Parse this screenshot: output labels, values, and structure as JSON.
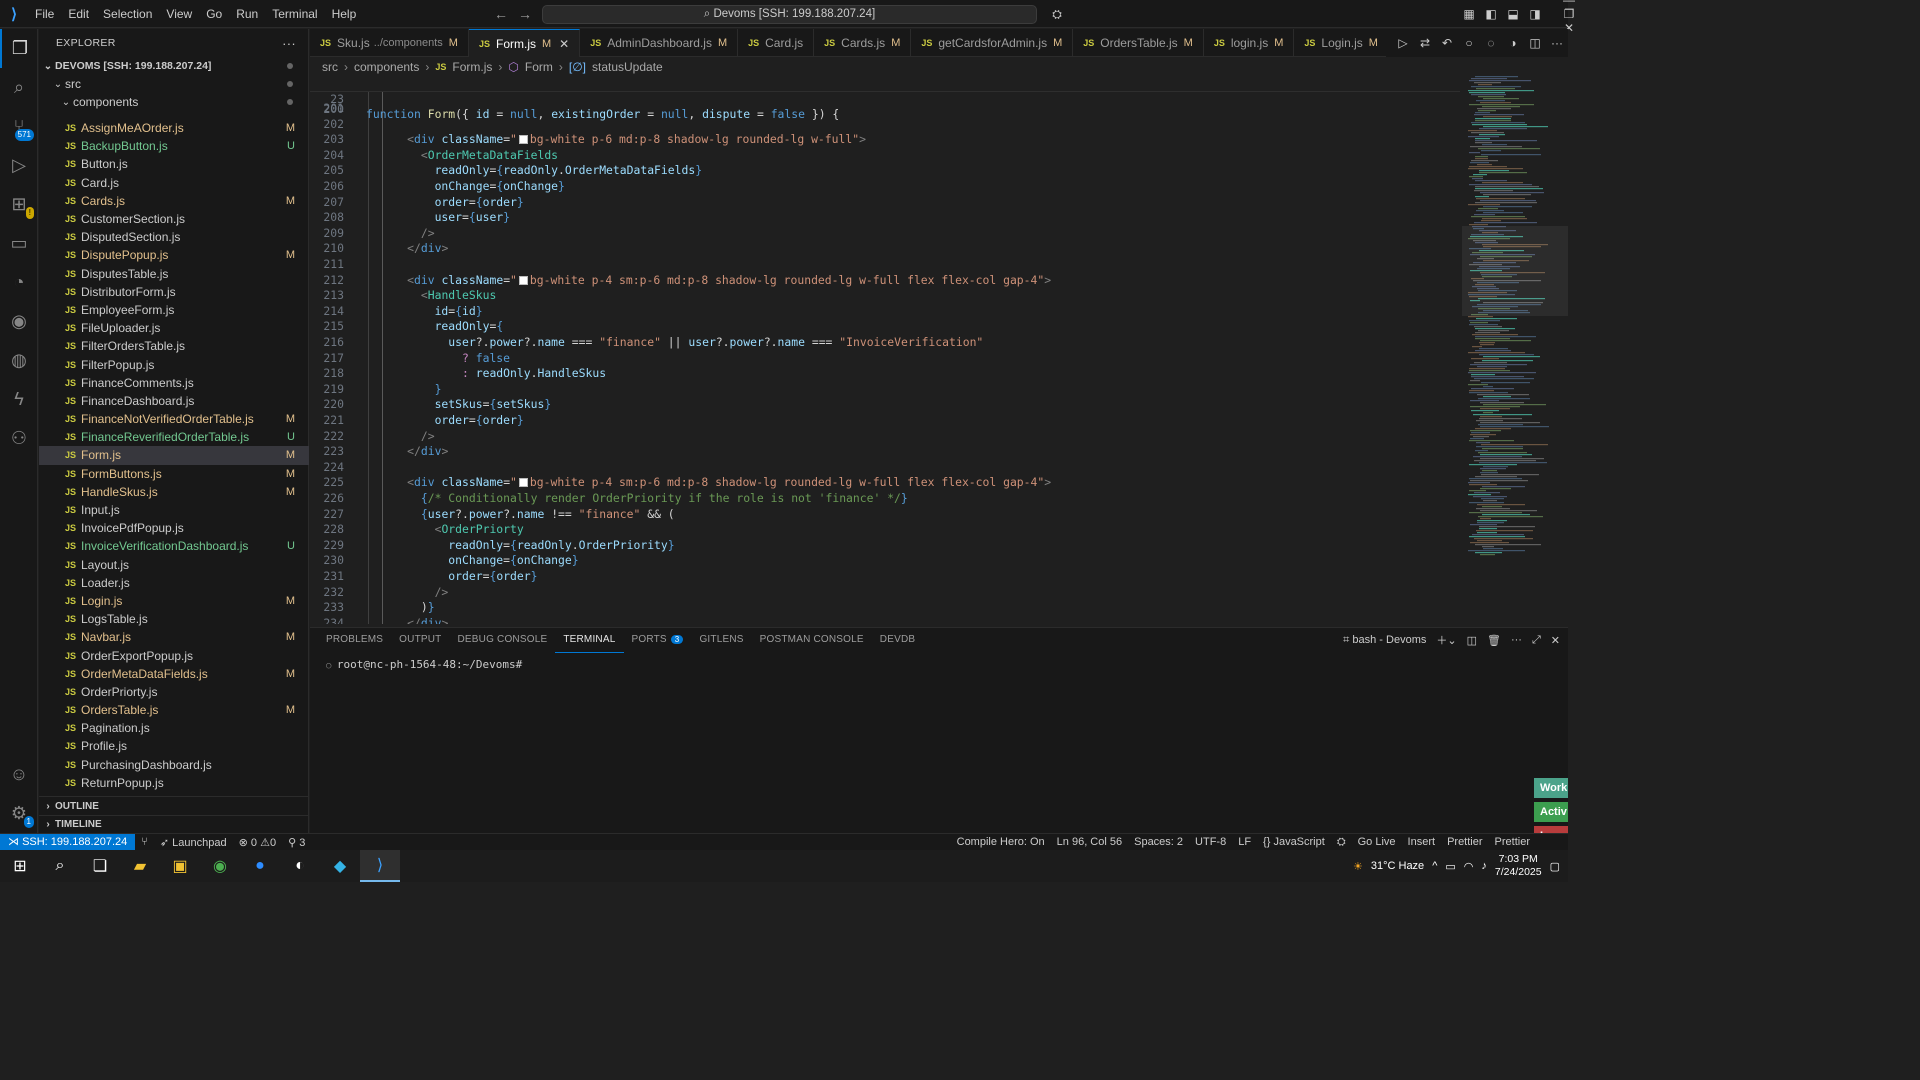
{
  "titlebar": {
    "menu": [
      "File",
      "Edit",
      "Selection",
      "View",
      "Go",
      "Run",
      "Terminal",
      "Help"
    ],
    "command_center": "Devoms [SSH: 199.188.207.24]"
  },
  "activity": {
    "scm_badge": "571",
    "settings_badge": "1"
  },
  "sidebar": {
    "title": "EXPLORER",
    "root": "DEVOMS [SSH: 199.188.207.24]",
    "src": "src",
    "components": "components",
    "files": [
      {
        "name": "AssignMeAOrder.js",
        "status": "M"
      },
      {
        "name": "BackupButton.js",
        "status": "U"
      },
      {
        "name": "Button.js",
        "status": ""
      },
      {
        "name": "Card.js",
        "status": ""
      },
      {
        "name": "Cards.js",
        "status": "M"
      },
      {
        "name": "CustomerSection.js",
        "status": ""
      },
      {
        "name": "DisputedSection.js",
        "status": ""
      },
      {
        "name": "DisputePopup.js",
        "status": "M"
      },
      {
        "name": "DisputesTable.js",
        "status": ""
      },
      {
        "name": "DistributorForm.js",
        "status": ""
      },
      {
        "name": "EmployeeForm.js",
        "status": ""
      },
      {
        "name": "FileUploader.js",
        "status": ""
      },
      {
        "name": "FilterOrdersTable.js",
        "status": ""
      },
      {
        "name": "FilterPopup.js",
        "status": ""
      },
      {
        "name": "FinanceComments.js",
        "status": ""
      },
      {
        "name": "FinanceDashboard.js",
        "status": ""
      },
      {
        "name": "FinanceNotVerifiedOrderTable.js",
        "status": "M"
      },
      {
        "name": "FinanceReverifiedOrderTable.js",
        "status": "U"
      },
      {
        "name": "Form.js",
        "status": "M"
      },
      {
        "name": "FormButtons.js",
        "status": "M"
      },
      {
        "name": "HandleSkus.js",
        "status": "M"
      },
      {
        "name": "Input.js",
        "status": ""
      },
      {
        "name": "InvoicePdfPopup.js",
        "status": ""
      },
      {
        "name": "InvoiceVerificationDashboard.js",
        "status": "U"
      },
      {
        "name": "Layout.js",
        "status": ""
      },
      {
        "name": "Loader.js",
        "status": ""
      },
      {
        "name": "Login.js",
        "status": "M"
      },
      {
        "name": "LogsTable.js",
        "status": ""
      },
      {
        "name": "Navbar.js",
        "status": "M"
      },
      {
        "name": "OrderExportPopup.js",
        "status": ""
      },
      {
        "name": "OrderMetaDataFields.js",
        "status": "M"
      },
      {
        "name": "OrderPriorty.js",
        "status": ""
      },
      {
        "name": "OrdersTable.js",
        "status": "M"
      },
      {
        "name": "Pagination.js",
        "status": ""
      },
      {
        "name": "Profile.js",
        "status": ""
      },
      {
        "name": "PurchasingDashboard.js",
        "status": ""
      },
      {
        "name": "ReturnPopup.js",
        "status": ""
      }
    ],
    "outline": "OUTLINE",
    "timeline": "TIMELINE"
  },
  "tabs": [
    {
      "name": "Sku.js",
      "desc": "../components",
      "status": "M"
    },
    {
      "name": "Form.js",
      "desc": "",
      "status": "M",
      "active": true
    },
    {
      "name": "AdminDashboard.js",
      "desc": "",
      "status": "M"
    },
    {
      "name": "Card.js",
      "desc": "",
      "status": ""
    },
    {
      "name": "Cards.js",
      "desc": "",
      "status": "M"
    },
    {
      "name": "getCardsforAdmin.js",
      "desc": "",
      "status": "M"
    },
    {
      "name": "OrdersTable.js",
      "desc": "",
      "status": "M"
    },
    {
      "name": "login.js",
      "desc": "",
      "status": "M"
    },
    {
      "name": "Login.js",
      "desc": "",
      "status": "M"
    }
  ],
  "breadcrumb": [
    "src",
    "components",
    "Form.js",
    "Form",
    "statusUpdate"
  ],
  "editor": {
    "sticky_line": {
      "num": "23",
      "text": "function Form({ id = null, existingOrder = null, dispute = false }) {"
    },
    "first_visible": "200",
    "lines": [
      {
        "num": "201",
        "text": ""
      },
      {
        "num": "202",
        "text": ""
      },
      {
        "num": "203",
        "text": "      <div className=\"bg-white p-6 md:p-8 shadow-lg rounded-lg w-full\">"
      },
      {
        "num": "204",
        "text": "        <OrderMetaDataFields"
      },
      {
        "num": "205",
        "text": "          readOnly={readOnly.OrderMetaDataFields}"
      },
      {
        "num": "206",
        "text": "          onChange={onChange}"
      },
      {
        "num": "207",
        "text": "          order={order}"
      },
      {
        "num": "208",
        "text": "          user={user}"
      },
      {
        "num": "209",
        "text": "        />"
      },
      {
        "num": "210",
        "text": "      </div>"
      },
      {
        "num": "211",
        "text": ""
      },
      {
        "num": "212",
        "text": "      <div className=\"bg-white p-4 sm:p-6 md:p-8 shadow-lg rounded-lg w-full flex flex-col gap-4\">"
      },
      {
        "num": "213",
        "text": "        <HandleSkus"
      },
      {
        "num": "214",
        "text": "          id={id}"
      },
      {
        "num": "215",
        "text": "          readOnly={"
      },
      {
        "num": "216",
        "text": "            user?.power?.name === \"finance\" || user?.power?.name === \"InvoiceVerification\""
      },
      {
        "num": "217",
        "text": "              ? false"
      },
      {
        "num": "218",
        "text": "              : readOnly.HandleSkus"
      },
      {
        "num": "219",
        "text": "          }"
      },
      {
        "num": "220",
        "text": "          setSkus={setSkus}"
      },
      {
        "num": "221",
        "text": "          order={order}"
      },
      {
        "num": "222",
        "text": "        />"
      },
      {
        "num": "223",
        "text": "      </div>"
      },
      {
        "num": "224",
        "text": ""
      },
      {
        "num": "225",
        "text": "      <div className=\"bg-white p-4 sm:p-6 md:p-8 shadow-lg rounded-lg w-full flex flex-col gap-4\">"
      },
      {
        "num": "226",
        "text": "        {/* Conditionally render OrderPriority if the role is not 'finance' */}"
      },
      {
        "num": "227",
        "text": "        {user?.power?.name !== \"finance\" && ("
      },
      {
        "num": "228",
        "text": "          <OrderPriorty"
      },
      {
        "num": "229",
        "text": "            readOnly={readOnly.OrderPriority}"
      },
      {
        "num": "230",
        "text": "            onChange={onChange}"
      },
      {
        "num": "231",
        "text": "            order={order}"
      },
      {
        "num": "232",
        "text": "          />"
      },
      {
        "num": "233",
        "text": "        )}"
      },
      {
        "num": "234",
        "text": "      </div>"
      }
    ]
  },
  "panel": {
    "tabs": [
      "PROBLEMS",
      "OUTPUT",
      "DEBUG CONSOLE",
      "TERMINAL",
      "PORTS",
      "GITLENS",
      "POSTMAN CONSOLE",
      "DEVDB"
    ],
    "active_tab": "TERMINAL",
    "ports_badge": "3",
    "shell_label": "bash - Devoms",
    "prompt": "root@nc-ph-1564-48:~/Devoms#",
    "side_labels": [
      "Work",
      "Activ",
      "In Act"
    ]
  },
  "statusbar": {
    "remote": "SSH: 199.188.207.24",
    "launchpad": "Launchpad",
    "errors": "0",
    "warnings": "0",
    "ports": "3",
    "right": [
      "Compile Hero: On",
      "Ln 96, Col 56",
      "Spaces: 2",
      "UTF-8",
      "LF",
      "{} JavaScript",
      "Go Live",
      "Insert",
      "Prettier",
      "Prettier"
    ]
  },
  "taskbar": {
    "weather": "31°C  Haze",
    "time": "7:03 PM",
    "date": "7/24/2025"
  },
  "colors": {
    "accent": "#0078d4",
    "modified": "#e2c08d",
    "untracked": "#73c991",
    "editor_bg": "#1f1f1f",
    "chrome_bg": "#181818"
  }
}
